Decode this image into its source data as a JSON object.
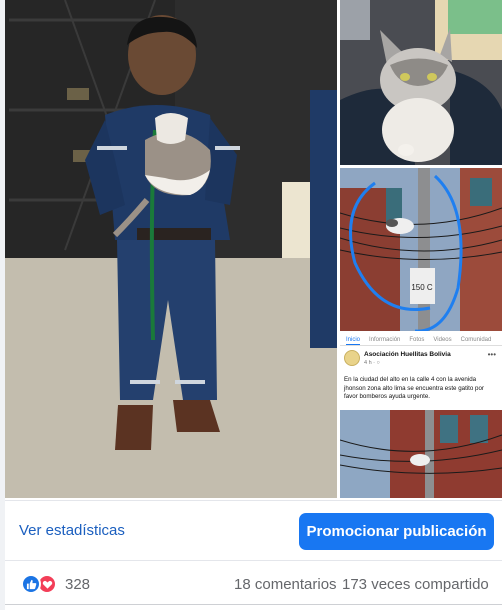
{
  "embedded_post": {
    "tabs": [
      "Inicio",
      "Información",
      "Fotos",
      "Videos",
      "Comunidad"
    ],
    "page_name": "Asociación Huellitas Bolivia",
    "time": "4 h · ",
    "text": "En la ciudad del alto en la calle 4 con la avenida jhonson zona alto lima se encuentra este gatito por favor bomberos ayuda urgente.",
    "sign_text": "150 C"
  },
  "actions": {
    "stats_label": "Ver estadísticas",
    "promote_label": "Promocionar publicación"
  },
  "reactions": {
    "count": "328",
    "comments": "18 comentarios",
    "shares": "173 veces compartido"
  },
  "colors": {
    "accent": "#1877f2",
    "link": "#1b5fbf",
    "like": "#1b74e4",
    "love": "#f33e58"
  }
}
